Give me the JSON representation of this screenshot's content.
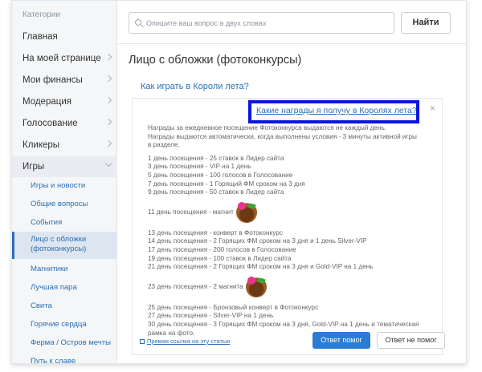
{
  "sidebar": {
    "header": "Категории",
    "items": [
      {
        "label": "Главная"
      },
      {
        "label": "На моей странице"
      },
      {
        "label": "Мои финансы"
      },
      {
        "label": "Модерация"
      },
      {
        "label": "Голосование"
      },
      {
        "label": "Кликеры"
      },
      {
        "label": "Игры"
      }
    ],
    "sub_items": [
      {
        "label": "Игры и новости"
      },
      {
        "label": "Общие вопросы"
      },
      {
        "label": "События"
      },
      {
        "label": "Лицо с обложки (фотоконкурсы)"
      },
      {
        "label": "Магнитики"
      },
      {
        "label": "Лучшая пара"
      },
      {
        "label": "Свита"
      },
      {
        "label": "Горячие сердца"
      },
      {
        "label": "Ферма / Остров мечты"
      },
      {
        "label": "Путь к славе"
      }
    ]
  },
  "search": {
    "placeholder": "Опишите ваш вопрос в двух словах",
    "button_label": "Найти"
  },
  "main": {
    "title": "Лицо с обложки (фотоконкурсы)",
    "question_1": "Как играть в Короли лета?",
    "question_2": "Какие награды я получу в Королях лета?",
    "close_symbol": "×",
    "answer_intro": [
      "Награды за ежедневное посещение Фотоконкурса выдаются не каждый день.",
      "Награды выдаются автоматически, когда выполнены условия - 3 минуты активной игры",
      "в разделе."
    ],
    "answer_lines": [
      "1 день посещения -  25 ставок в Лидер сайта",
      "3 день посещения - VIP на 1 день",
      "5 день посещения - 100 голосов в Голосование",
      "7 день посещения - 1 Горящий ФМ сроком на 3 дня",
      "9 день посещения - 50 ставок  в Лидер сайта",
      "11 день посещения - магнит",
      "13 день посещения -  конверт в Фотоконкурс",
      "14 день посещения - 2 Горящих ФМ сроком на 3 дня и 1 день Silver-VIP",
      "17 день посещения - 200  голосов в Голосование",
      "19 день посещения - 100 ставок в Лидер сайта",
      "21 день посещения - 2 Горящих ФМ сроком на 3 дня и Gold-VIP на 1 день",
      "23 день посещения - 2 магнита",
      "25 день посещения - Бронзовый конверт в Фотоконкурс",
      "27 день посещения - Silver-VIP на 1 день",
      "30 день посещения - 3 Горящих ФМ сроком на 3 дня, Gold-VIP на 1 день и тематическая рамка на фото."
    ],
    "direct_link": "Прямая ссылка на эту статью",
    "helpful_button": "Ответ помог",
    "not_helpful_button": "Ответ не помог"
  },
  "colors": {
    "accent": "#2a7dd3",
    "link": "#2a6fb4",
    "highlight_box": "#0b14e0"
  }
}
